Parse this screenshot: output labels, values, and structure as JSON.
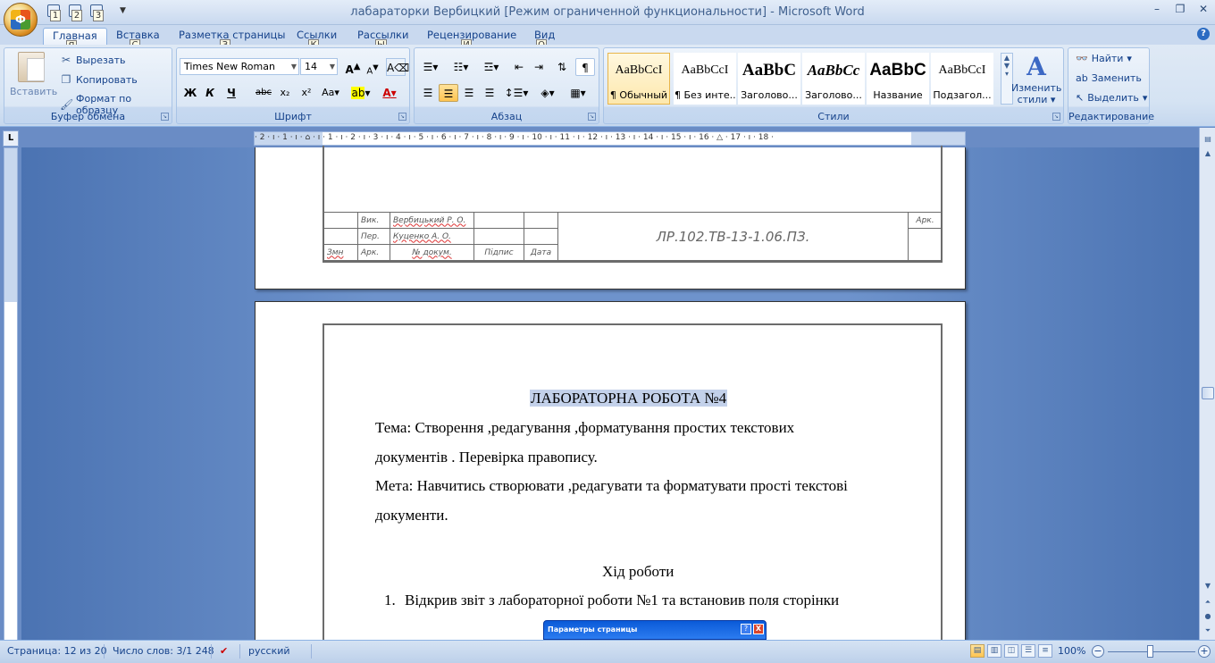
{
  "window": {
    "title": "лабараторки Вербицкий [Режим ограниченной функциональности] - Microsoft Word",
    "office_button_letter": "Ф",
    "qat_keys": [
      "1",
      "2",
      "3"
    ]
  },
  "tabs": [
    {
      "label": "Главная",
      "key": "Я",
      "active": true
    },
    {
      "label": "Вставка",
      "key": "С"
    },
    {
      "label": "Разметка страницы",
      "key": "З"
    },
    {
      "label": "Ссылки",
      "key": "К"
    },
    {
      "label": "Рассылки",
      "key": "Ы"
    },
    {
      "label": "Рецензирование",
      "key": "И"
    },
    {
      "label": "Вид",
      "key": "О"
    }
  ],
  "clipboard": {
    "paste": "Вставить",
    "cut": "Вырезать",
    "copy": "Копировать",
    "format_painter": "Формат по образцу",
    "group_label": "Буфер обмена"
  },
  "font": {
    "name": "Times New Roman",
    "size": "14",
    "bold": "Ж",
    "italic": "К",
    "underline": "Ч",
    "strike": "abc",
    "subscript": "x₂",
    "superscript": "x²",
    "case": "Aa",
    "grow": "A",
    "shrink": "A",
    "group_label": "Шрифт"
  },
  "paragraph": {
    "group_label": "Абзац",
    "show_marks": "¶"
  },
  "styles": {
    "group_label": "Стили",
    "items": [
      {
        "sample": "AaBbCcI",
        "name": "¶ Обычный",
        "selected": true
      },
      {
        "sample": "AaBbCcI",
        "name": "¶ Без инте..."
      },
      {
        "sample": "AaBbC",
        "name": "Заголово..."
      },
      {
        "sample": "AaBbCc",
        "name": "Заголово..."
      },
      {
        "sample": "AaBbC",
        "name": "Название"
      },
      {
        "sample": "AaBbCcI",
        "name": "Подзагол..."
      }
    ],
    "change_styles_line1": "Изменить",
    "change_styles_line2": "стили"
  },
  "editing": {
    "find": "Найти",
    "replace": "Заменить",
    "select": "Выделить",
    "group_label": "Редактирование"
  },
  "ruler": {
    "numbers": "· 2 · ı · 1 · ı · ⌂ · ı · 1 · ı · 2 · ı · 3 · ı · 4 · ı · 5 · ı · 6 · ı · 7 · ı · 8 · ı · 9 · ı · 10 · ı · 11 · ı · 12 · ı · 13 · ı · 14 · ı · 15 · ı · 16 · △ · 17 · ı · 18 ·"
  },
  "stamp": {
    "viк": "Вик.",
    "per": "Пер.",
    "name1": "Вербицький Р. О.",
    "name2": "Куценко А. О.",
    "zmn": "Змн",
    "ark": "Арк.",
    "ndokum": "№ докум.",
    "pidpys": "Підпис",
    "data": "Дата",
    "code": "ЛР.102.ТВ-13-1.06.ПЗ.",
    "ark_right": "Арк."
  },
  "document": {
    "heading": "ЛАБОРАТОРНА РОБОТА №4",
    "tema_line1": "Тема: Створення ,редагування ,форматування простих текстових",
    "tema_line2": "документів . Перевірка правопису.",
    "meta_line1": "Мета: Навчитись створювати ,редагувати та форматувати прості текстові",
    "meta_line2": "документи.",
    "progress_title": "Хід роботи",
    "item1_num": "1.",
    "item1": "Відкрив звіт з лабораторної роботи №1 та встановив поля сторінки"
  },
  "dialog": {
    "title": "Параметры страницы",
    "help": "?",
    "close": "X"
  },
  "statusbar": {
    "page": "Страница: 12 из 20",
    "words": "Число слов: 3/1 248",
    "language": "русский",
    "zoom": "100%"
  }
}
